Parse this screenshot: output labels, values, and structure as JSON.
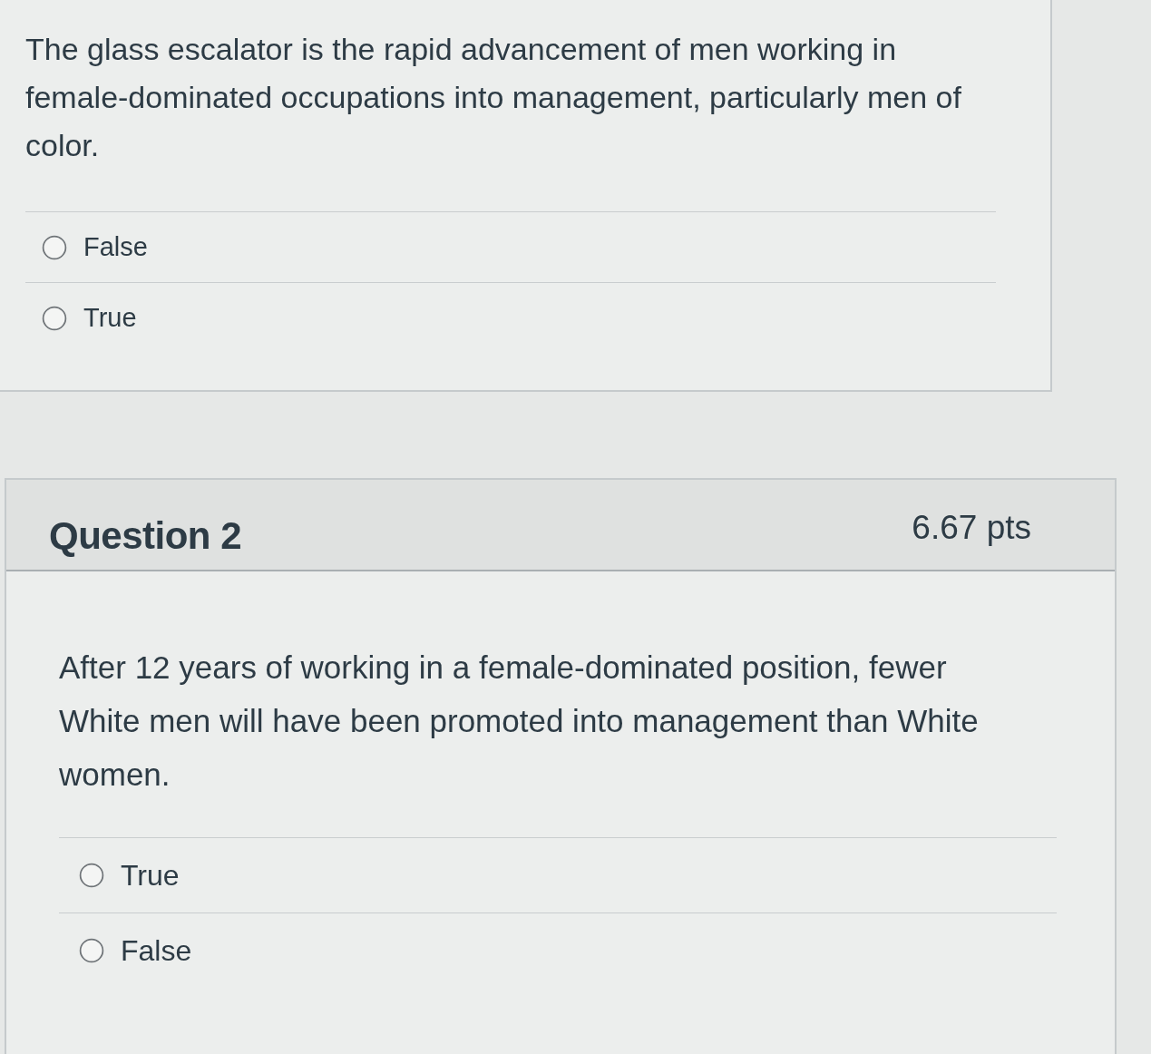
{
  "questions": [
    {
      "text": "The glass escalator is the rapid advancement of men working in female-dominated occupations into management, particularly men of color.",
      "answers": [
        {
          "label": "False",
          "selected": false
        },
        {
          "label": "True",
          "selected": false
        }
      ]
    },
    {
      "title": "Question 2",
      "points": "6.67 pts",
      "text": "After 12 years of working in a female-dominated position, fewer White men will have been promoted into management than White women.",
      "answers": [
        {
          "label": "True",
          "selected": false
        },
        {
          "label": "False",
          "selected": false
        }
      ]
    }
  ]
}
